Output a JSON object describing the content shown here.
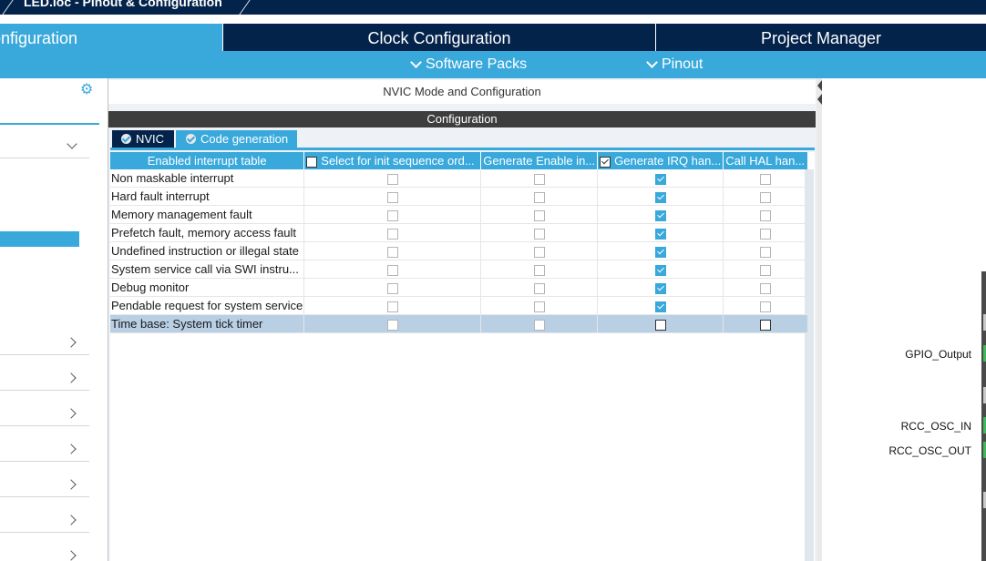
{
  "window": {
    "title": "LED.ioc - Pinout & Configuration"
  },
  "main_tabs": [
    {
      "label": "onfiguration"
    },
    {
      "label": "Clock Configuration"
    },
    {
      "label": "Project Manager"
    }
  ],
  "sub_bar": {
    "software_packs": "Software Packs",
    "pinout": "Pinout"
  },
  "center": {
    "mode_header": "NVIC Mode and Configuration",
    "config_bar": "Configuration",
    "subtabs": [
      {
        "label": "NVIC"
      },
      {
        "label": "Code generation"
      }
    ]
  },
  "table": {
    "headers": [
      "Enabled interrupt table",
      "Select for init sequence ord...",
      "Generate Enable in...",
      "Generate IRQ han...",
      "Call HAL han..."
    ],
    "header_checks": [
      false,
      false,
      true,
      false
    ],
    "rows": [
      {
        "name": "Non maskable interrupt",
        "checks": [
          false,
          false,
          true,
          false
        ]
      },
      {
        "name": "Hard fault interrupt",
        "checks": [
          false,
          false,
          true,
          false
        ]
      },
      {
        "name": "Memory management fault",
        "checks": [
          false,
          false,
          true,
          false
        ]
      },
      {
        "name": "Prefetch fault, memory access fault",
        "checks": [
          false,
          false,
          true,
          false
        ]
      },
      {
        "name": "Undefined instruction or illegal state",
        "checks": [
          false,
          false,
          true,
          false
        ]
      },
      {
        "name": "System service call via SWI instru...",
        "checks": [
          false,
          false,
          true,
          false
        ]
      },
      {
        "name": "Debug monitor",
        "checks": [
          false,
          false,
          true,
          false
        ]
      },
      {
        "name": "Pendable request for system service",
        "checks": [
          false,
          false,
          true,
          false
        ]
      },
      {
        "name": "Time base: System tick timer",
        "checks": [
          false,
          false,
          false,
          false
        ],
        "selected": true
      }
    ]
  },
  "pin_labels": [
    "GPIO_Output",
    "RCC_OSC_IN",
    "RCC_OSC_OUT"
  ],
  "colors": {
    "dark_navy": "#03234b",
    "accent_blue": "#39a9dc",
    "selected_row": "#b8cfe4"
  }
}
